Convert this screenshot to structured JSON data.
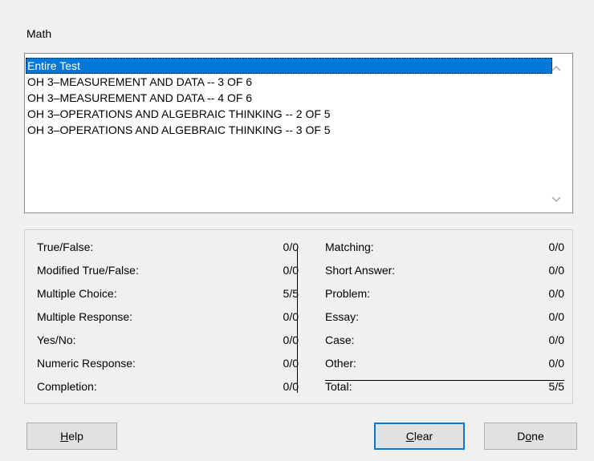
{
  "dialog": {
    "section_label": "Math"
  },
  "list": {
    "items": [
      {
        "label": "Entire Test",
        "selected": true
      },
      {
        "label": "OH 3–MEASUREMENT AND DATA -- 3 OF 6",
        "selected": false
      },
      {
        "label": "OH 3–MEASUREMENT AND DATA -- 4 OF 6",
        "selected": false
      },
      {
        "label": "OH 3–OPERATIONS AND ALGEBRAIC THINKING -- 2 OF 5",
        "selected": false
      },
      {
        "label": "OH 3–OPERATIONS AND ALGEBRAIC THINKING -- 3 OF 5",
        "selected": false
      }
    ],
    "scroll_up_icon": "chevron-up-icon",
    "scroll_down_icon": "chevron-down-icon"
  },
  "stats": {
    "left": [
      {
        "label": "True/False:",
        "value": "0/0"
      },
      {
        "label": "Modified True/False:",
        "value": "0/0"
      },
      {
        "label": "Multiple Choice:",
        "value": "5/5"
      },
      {
        "label": "Multiple Response:",
        "value": "0/0"
      },
      {
        "label": "Yes/No:",
        "value": "0/0"
      },
      {
        "label": "Numeric Response:",
        "value": "0/0"
      },
      {
        "label": "Completion:",
        "value": "0/0"
      }
    ],
    "right": [
      {
        "label": "Matching:",
        "value": "0/0"
      },
      {
        "label": "Short Answer:",
        "value": "0/0"
      },
      {
        "label": "Problem:",
        "value": "0/0"
      },
      {
        "label": "Essay:",
        "value": "0/0"
      },
      {
        "label": "Case:",
        "value": "0/0"
      },
      {
        "label": "Other:",
        "value": "0/0"
      },
      {
        "label": "Total:",
        "value": "5/5"
      }
    ]
  },
  "buttons": {
    "help": {
      "pre": "",
      "mnemonic": "H",
      "post": "elp"
    },
    "clear": {
      "pre": "",
      "mnemonic": "C",
      "post": "lear"
    },
    "done": {
      "pre": "D",
      "mnemonic": "o",
      "post": "ne"
    }
  },
  "colors": {
    "selection": "#0078d7",
    "dialog_bg": "#f0f0f0",
    "default_button_border": "#0078d7"
  }
}
